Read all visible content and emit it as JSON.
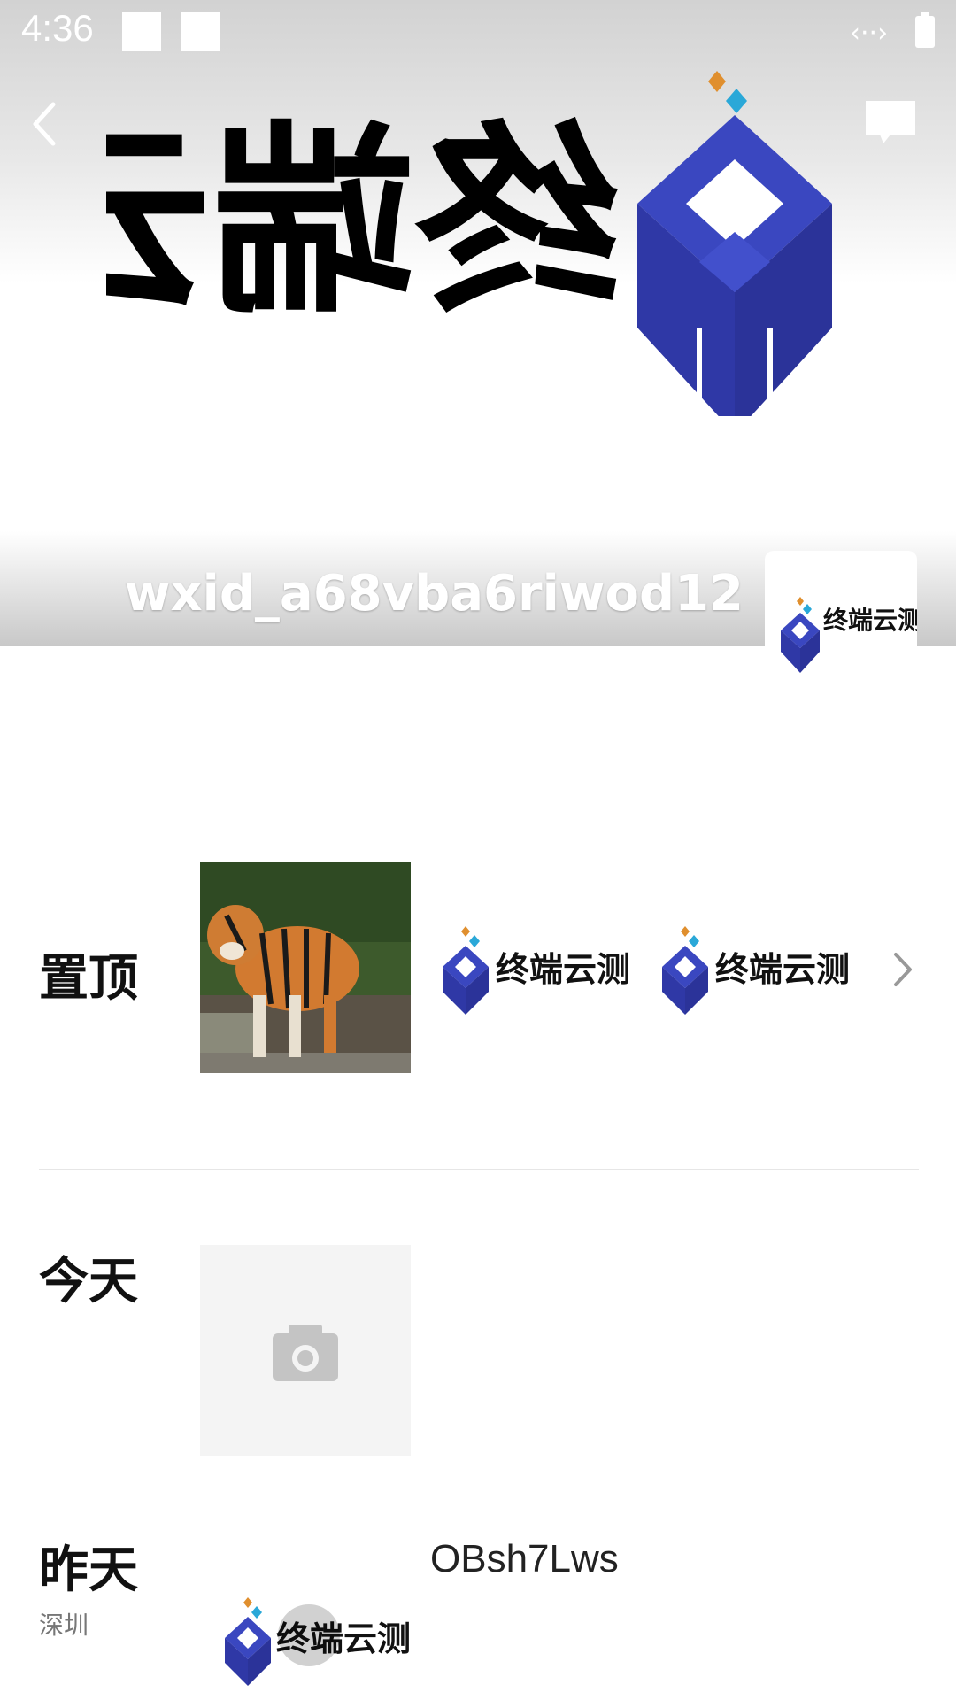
{
  "status_bar": {
    "time": "4:36",
    "signal_glyph": "‹··›"
  },
  "header": {
    "back_icon": "chevron-left-icon",
    "message_icon": "message-bubble-icon",
    "cover_logo_text": "终端云测",
    "profile_name": "wxid_a68vba6riwod12",
    "avatar_logo_text": "终端云测"
  },
  "timeline": {
    "pinned": {
      "label": "置顶",
      "items": [
        {
          "type": "photo",
          "subject": "tiger"
        },
        {
          "type": "logo",
          "text": "终端云测"
        },
        {
          "type": "logo",
          "text": "终端云测"
        }
      ],
      "more_icon": "chevron-right-icon"
    },
    "today": {
      "label": "今天",
      "placeholder_icon": "camera-icon"
    },
    "yesterday": {
      "label": "昨天",
      "location": "深圳",
      "post_text": "OBsh7Lws",
      "thumb_logo_text": "终端云测"
    }
  },
  "colors": {
    "brand_blue": "#3a47c0",
    "brand_orange": "#e08f2e",
    "brand_cyan": "#2aa8d8"
  }
}
